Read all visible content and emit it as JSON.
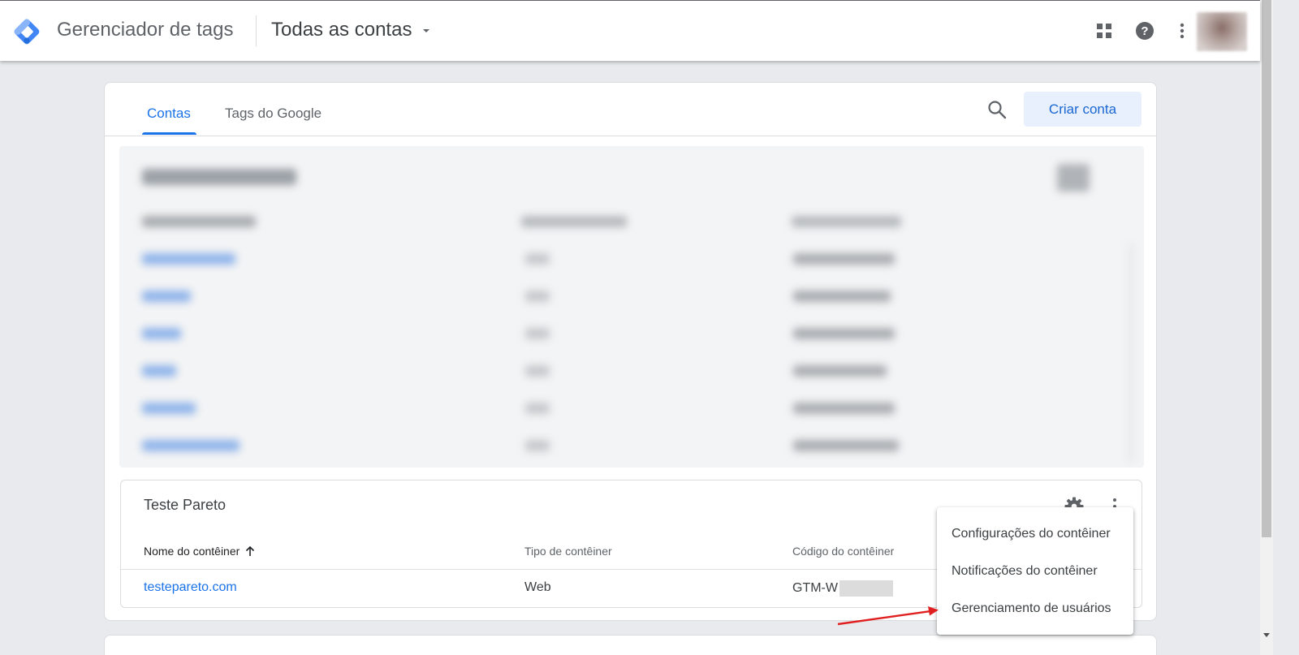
{
  "header": {
    "app_title": "Gerenciador de tags",
    "account_switch": "Todas as contas",
    "icons": [
      "apps-grid-icon",
      "help-icon",
      "more-vert-icon"
    ]
  },
  "tabs": [
    {
      "label": "Contas",
      "active": true
    },
    {
      "label": "Tags do Google",
      "active": false
    }
  ],
  "toolbar": {
    "create_account_label": "Criar conta"
  },
  "account": {
    "name": "Teste Pareto",
    "columns": [
      "Nome do contêiner",
      "Tipo de contêiner",
      "Código do contêiner"
    ],
    "rows": [
      {
        "name": "testepareto.com",
        "type": "Web",
        "code": "GTM-W"
      }
    ]
  },
  "menu": {
    "items": [
      "Configurações do contêiner",
      "Notificações do contêiner",
      "Gerenciamento de usuários"
    ]
  },
  "colors": {
    "accent": "#1a73e8",
    "create_button_bg": "#e8f0fe",
    "annotation_arrow": "#e02020"
  }
}
